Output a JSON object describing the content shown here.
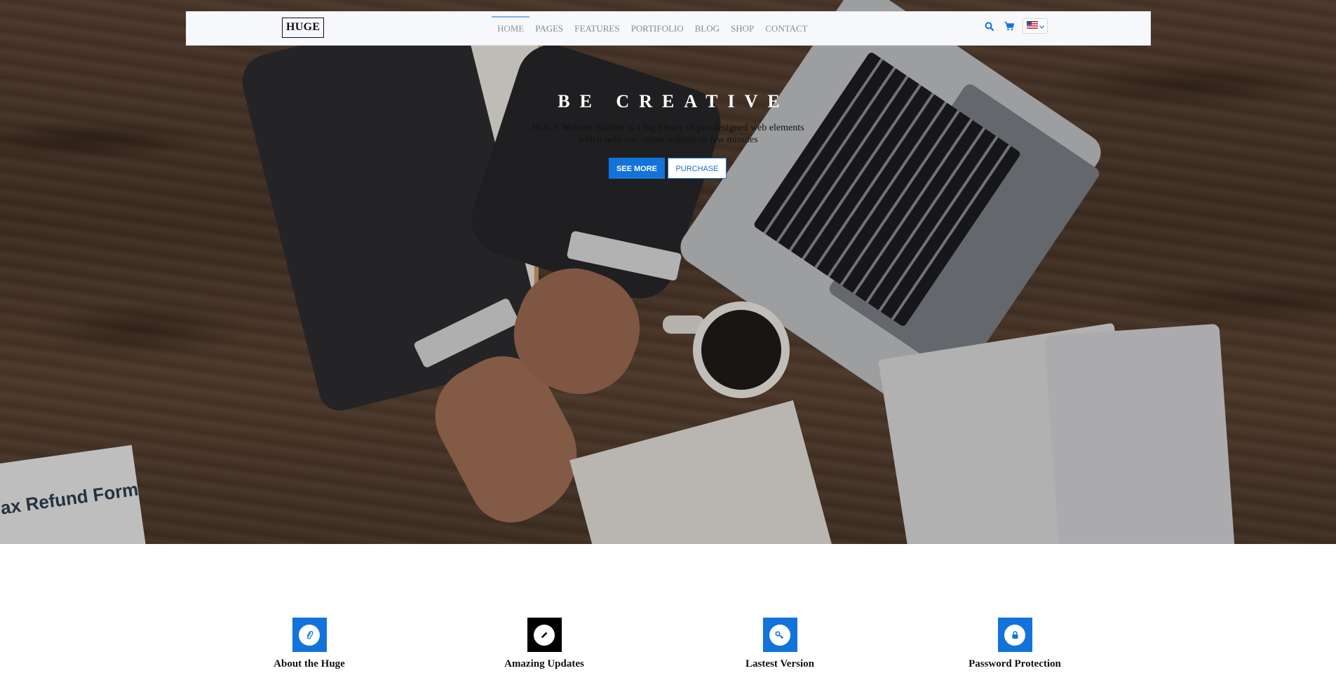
{
  "header": {
    "logo": "HUGE",
    "nav": [
      "HOME",
      "PAGES",
      "FEATURES",
      "PORTIFOLIO",
      "BLOG",
      "SHOP",
      "CONTACT"
    ],
    "active_nav": "HOME",
    "icons": [
      "search-icon",
      "cart-icon",
      "us-flag-icon",
      "chevron-down-icon"
    ]
  },
  "hero": {
    "title": "BE CREATIVE",
    "subtitle_line1": "HUGE Website Builder is a big library of pre-designed web elements",
    "subtitle_line2": "which help you create website in few minutes",
    "primary_button": "SEE MORE",
    "secondary_button": "PURCHASE",
    "background_text": "ax Refund Form"
  },
  "features": [
    {
      "title": "About the Huge",
      "icon": "paperclip-icon",
      "color": "#1273da"
    },
    {
      "title": "Amazing Updates",
      "icon": "pencil-icon",
      "color": "#000000"
    },
    {
      "title": "Lastest Version",
      "icon": "key-icon",
      "color": "#1273da"
    },
    {
      "title": "Password Protection",
      "icon": "lock-icon",
      "color": "#1273da"
    }
  ],
  "colors": {
    "accent": "#1273da",
    "header_bg": "#f7f8fc"
  }
}
